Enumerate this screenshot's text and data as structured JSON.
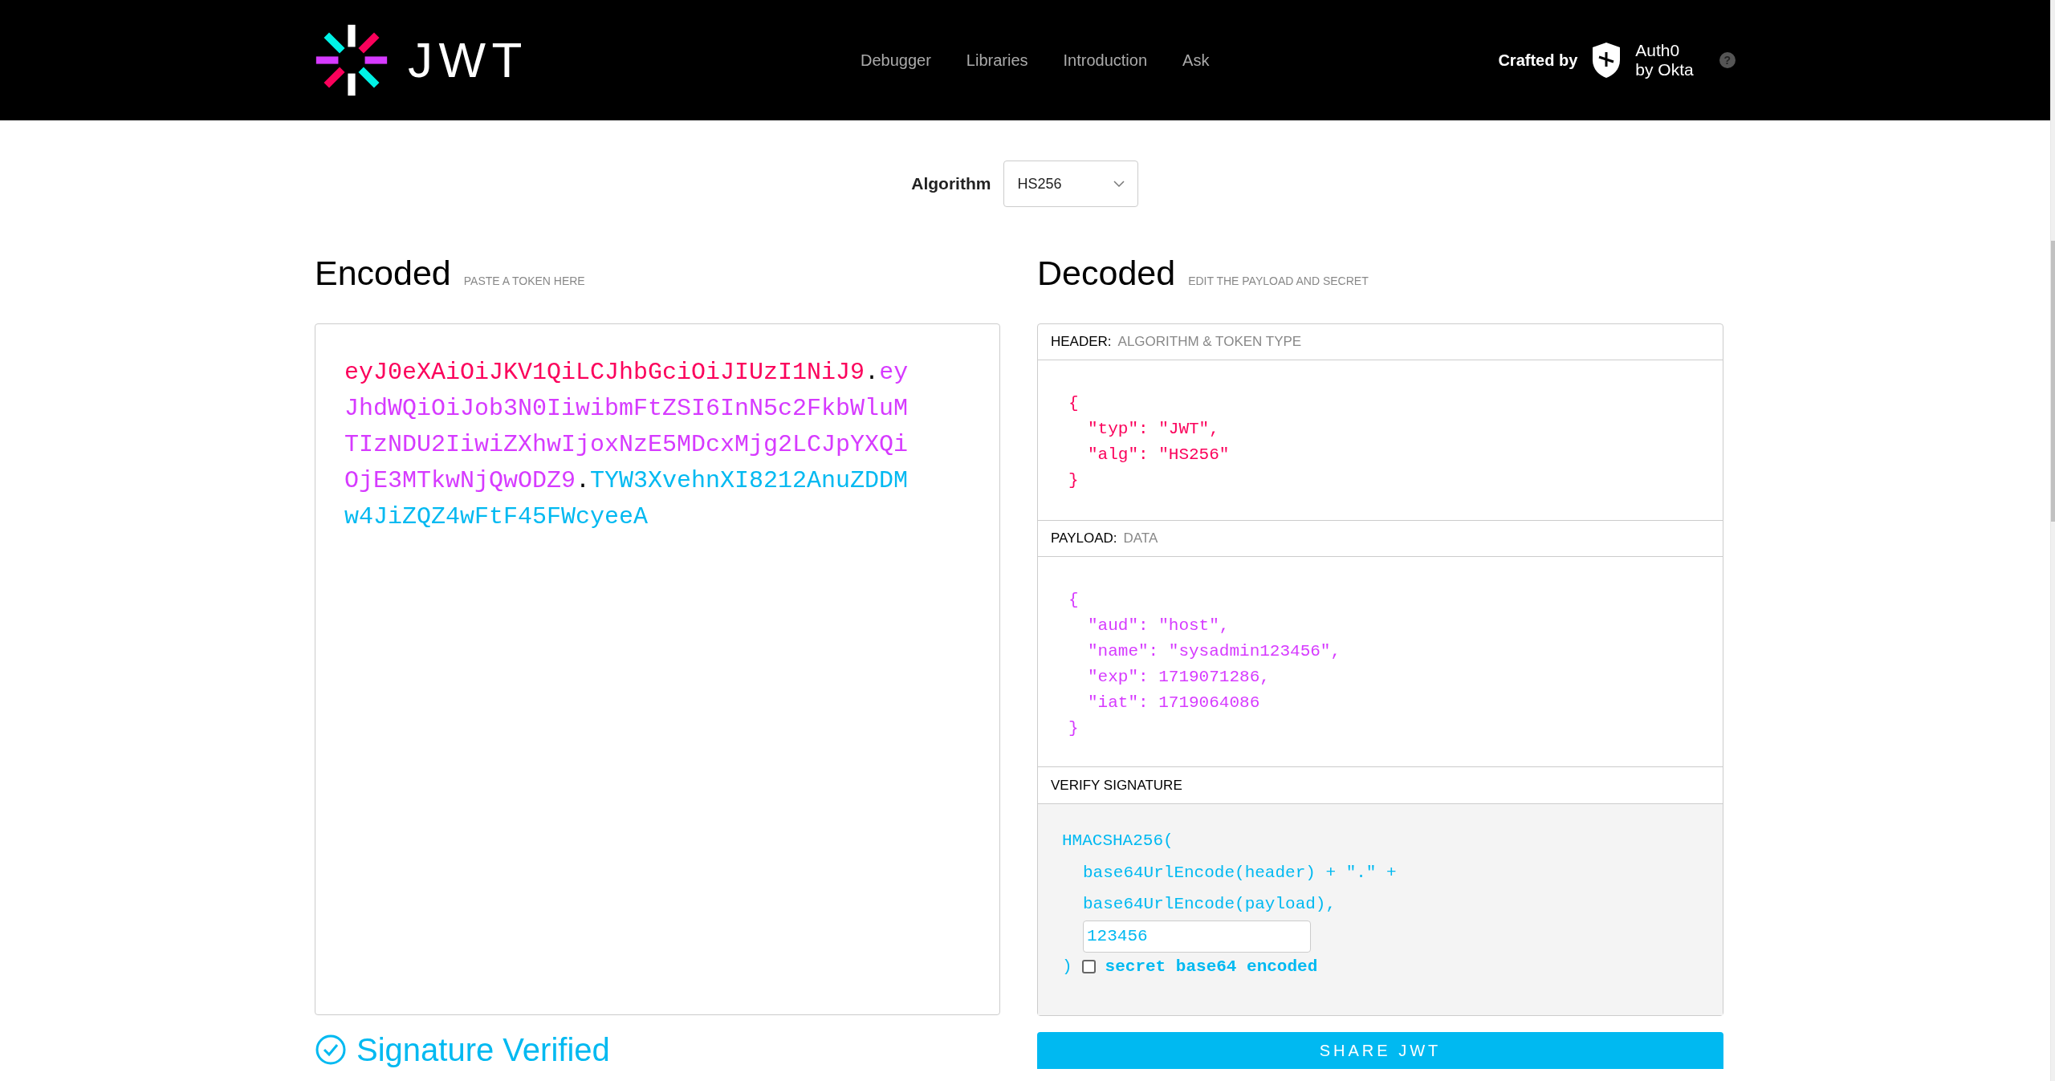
{
  "nav": {
    "logo_text": "JWT",
    "links": [
      {
        "label": "Debugger"
      },
      {
        "label": "Libraries"
      },
      {
        "label": "Introduction"
      },
      {
        "label": "Ask"
      }
    ],
    "crafted_by": "Crafted by",
    "brand_line_1": "Auth0",
    "brand_line_2": "by Okta",
    "help": "?"
  },
  "algorithm": {
    "label": "Algorithm",
    "value": "HS256"
  },
  "encoded": {
    "title": "Encoded",
    "hint": "PASTE A TOKEN HERE",
    "token_parts": [
      {
        "kind": "header",
        "text": "eyJ0eXAiOiJKV1QiLCJhbGciOiJIUzI1NiJ9"
      },
      {
        "kind": "dot",
        "text": "."
      },
      {
        "kind": "payload",
        "text": "eyJhdWQiOiJob3N0IiwibmFtZSI6InN5c2FkbWluMTIzNDU2IiwiZXhwIjoxNzE5MDcxMjg2LCJpYXQiOjE3MTkwNjQwODZ9"
      },
      {
        "kind": "dot",
        "text": "."
      },
      {
        "kind": "signature",
        "text": "TYW3XvehnXI8212AnuZDDMw4JiZQZ4wFtF45FWcyeeA"
      }
    ]
  },
  "decoded": {
    "title": "Decoded",
    "hint": "EDIT THE PAYLOAD AND SECRET",
    "sections": [
      {
        "kind": "header",
        "label": "HEADER:",
        "sublabel": "ALGORITHM & TOKEN TYPE",
        "open": "{",
        "entries": [
          "\"typ\": \"JWT\",",
          "\"alg\": \"HS256\""
        ],
        "close": "}"
      },
      {
        "kind": "payload",
        "label": "PAYLOAD:",
        "sublabel": "DATA",
        "open": "{",
        "entries": [
          "\"aud\": \"host\",",
          "\"name\": \"sysadmin123456\",",
          "\"exp\": 1719071286,",
          "\"iat\": 1719064086"
        ],
        "close": "}"
      }
    ],
    "verify": {
      "label": "VERIFY SIGNATURE",
      "lines": [
        "HMACSHA256(",
        "base64UrlEncode(header) + \".\" +",
        "base64UrlEncode(payload),"
      ],
      "secret": "123456",
      "close": ")",
      "base64_checked": false,
      "base64_label": "secret base64 encoded"
    }
  },
  "status": {
    "text": "Signature Verified"
  },
  "share_button": "SHARE JWT"
}
